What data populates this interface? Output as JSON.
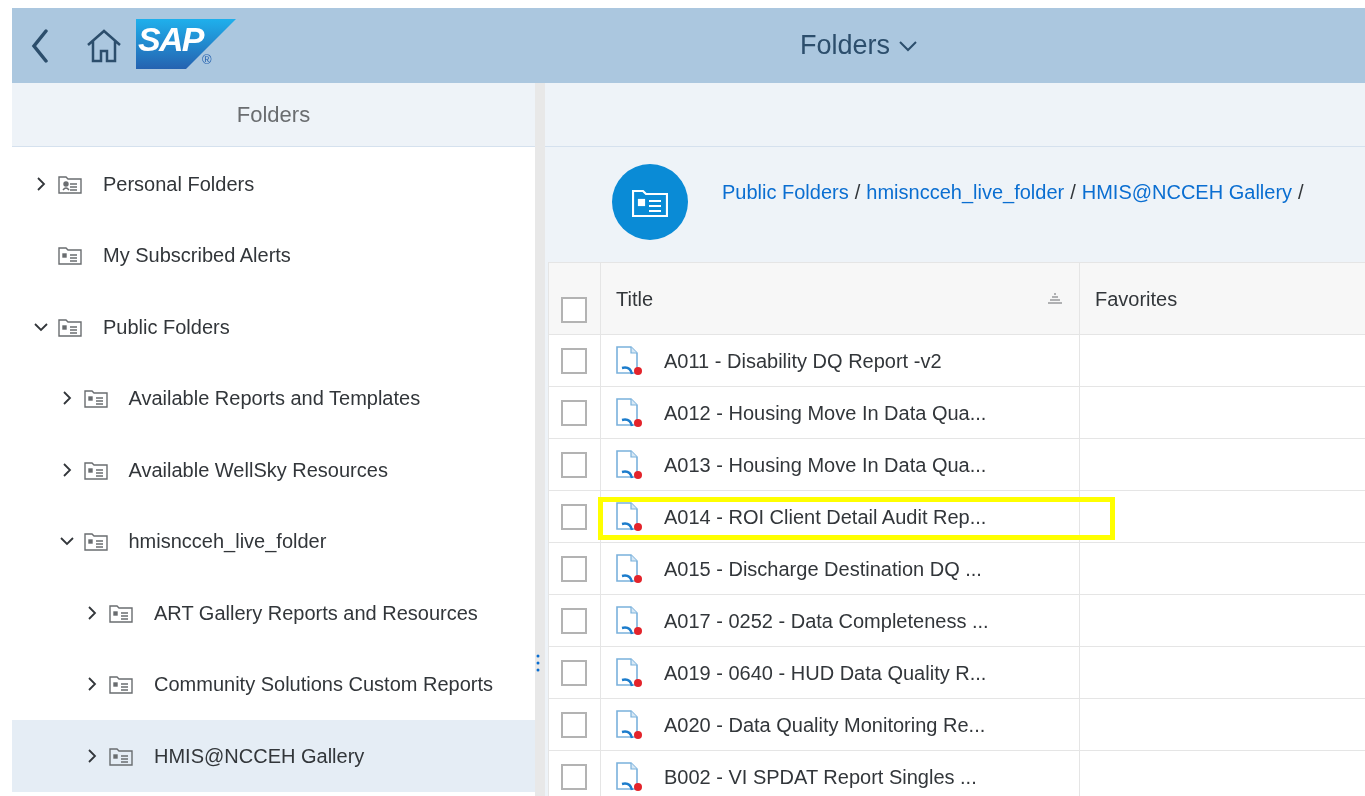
{
  "header": {
    "title": "Folders",
    "logo": "SAP",
    "logo_mark": "®"
  },
  "sidebar": {
    "title": "Folders",
    "items": [
      {
        "label": "Personal Folders",
        "expanded": false,
        "selected": false,
        "kind": "personal"
      },
      {
        "label": "My Subscribed Alerts",
        "selected": false,
        "kind": "folder"
      },
      {
        "label": "Public Folders",
        "expanded": true,
        "selected": false,
        "kind": "folder",
        "children": [
          {
            "label": "Available Reports and Templates",
            "expanded": false,
            "selected": false,
            "kind": "folder"
          },
          {
            "label": "Available WellSky Resources",
            "expanded": false,
            "selected": false,
            "kind": "folder"
          },
          {
            "label": "hmisncceh_live_folder",
            "expanded": true,
            "selected": false,
            "kind": "folder",
            "children": [
              {
                "label": "ART Gallery Reports and Resources",
                "expanded": false,
                "selected": false,
                "kind": "folder"
              },
              {
                "label": "Community Solutions Custom Reports",
                "expanded": false,
                "selected": false,
                "kind": "folder"
              },
              {
                "label": "HMIS@NCCEH Gallery",
                "expanded": false,
                "selected": true,
                "kind": "folder"
              }
            ]
          }
        ]
      }
    ]
  },
  "breadcrumb": {
    "separator": "/",
    "items": [
      "Public Folders",
      "hmisncceh_live_folder",
      "HMIS@NCCEH Gallery"
    ]
  },
  "table": {
    "select_all_checked": false,
    "columns": [
      "Title",
      "Favorites"
    ],
    "rows": [
      {
        "title": "A011 - Disability DQ Report -v2",
        "checked": false,
        "highlighted": false
      },
      {
        "title": "A012 - Housing Move In Data Qua...",
        "checked": false,
        "highlighted": false
      },
      {
        "title": "A013 - Housing Move In Data Qua...",
        "checked": false,
        "highlighted": false
      },
      {
        "title": "A014 - ROI Client Detail Audit Rep...",
        "checked": false,
        "highlighted": true
      },
      {
        "title": "A015 - Discharge Destination DQ ...",
        "checked": false,
        "highlighted": false
      },
      {
        "title": "A017 - 0252 - Data Completeness ...",
        "checked": false,
        "highlighted": false
      },
      {
        "title": "A019 - 0640 - HUD Data Quality R...",
        "checked": false,
        "highlighted": false
      },
      {
        "title": "A020 - Data Quality Monitoring Re...",
        "checked": false,
        "highlighted": false
      },
      {
        "title": "B002 - VI SPDAT Report  Singles  ...",
        "checked": false,
        "highlighted": false
      }
    ]
  }
}
